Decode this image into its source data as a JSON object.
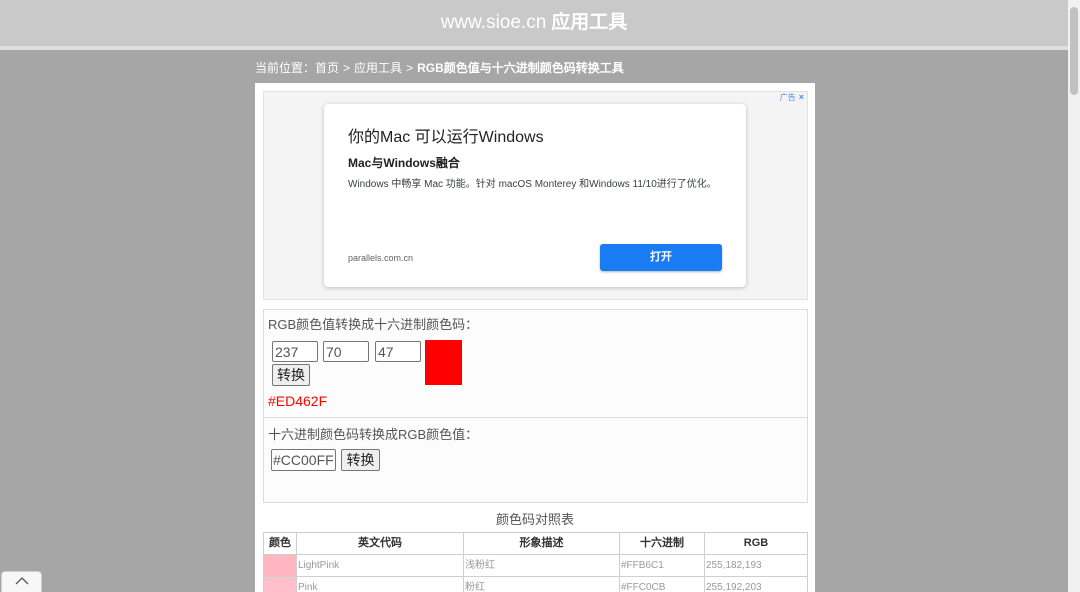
{
  "header": {
    "site": "www.sioe.cn",
    "section": "应用工具"
  },
  "breadcrumb": {
    "prefix": "当前位置：",
    "separator": ">",
    "links": [
      "首页",
      "应用工具"
    ],
    "current": "RGB颜色值与十六进制颜色码转换工具"
  },
  "ad": {
    "badge": "广告",
    "close": "×",
    "headline": "你的Mac 可以运行Windows",
    "subhead": "Mac与Windows融合",
    "body": "Windows 中畅享 Mac 功能。针对 macOS Monterey 和Windows 11/10进行了优化。",
    "domain": "parallels.com.cn",
    "cta": "打开"
  },
  "rgb_to_hex": {
    "label": "RGB颜色值转换成十六进制颜色码：",
    "r": "237",
    "g": "70",
    "b": "47",
    "button": "转换",
    "result": "#ED462F"
  },
  "hex_to_rgb": {
    "label": "十六进制颜色码转换成RGB颜色值：",
    "hex": "#CC00FF",
    "button": "转换"
  },
  "color_table": {
    "caption": "颜色码对照表",
    "headers": [
      "颜色",
      "英文代码",
      "形象描述",
      "十六进制",
      "RGB"
    ],
    "rows": [
      {
        "swatch": "#FFB6C1",
        "name": "LightPink",
        "desc": "浅粉红",
        "hex": "#FFB6C1",
        "rgb": "255,182,193"
      },
      {
        "swatch": "#FFC0CB",
        "name": "Pink",
        "desc": "粉红",
        "hex": "#FFC0CB",
        "rgb": "255,192,203"
      }
    ]
  },
  "colors": {
    "page_bg": "#A6A6A6",
    "header_bg": "#C9C9C9",
    "ad_cta": "#1A7CF2",
    "ad_badge": "#4A8CF0",
    "preview_swatch": "#FF0000",
    "result_text": "#FF0000"
  },
  "icons": {
    "ad_close": "close-icon",
    "back_to_top": "chevron-up-icon"
  }
}
